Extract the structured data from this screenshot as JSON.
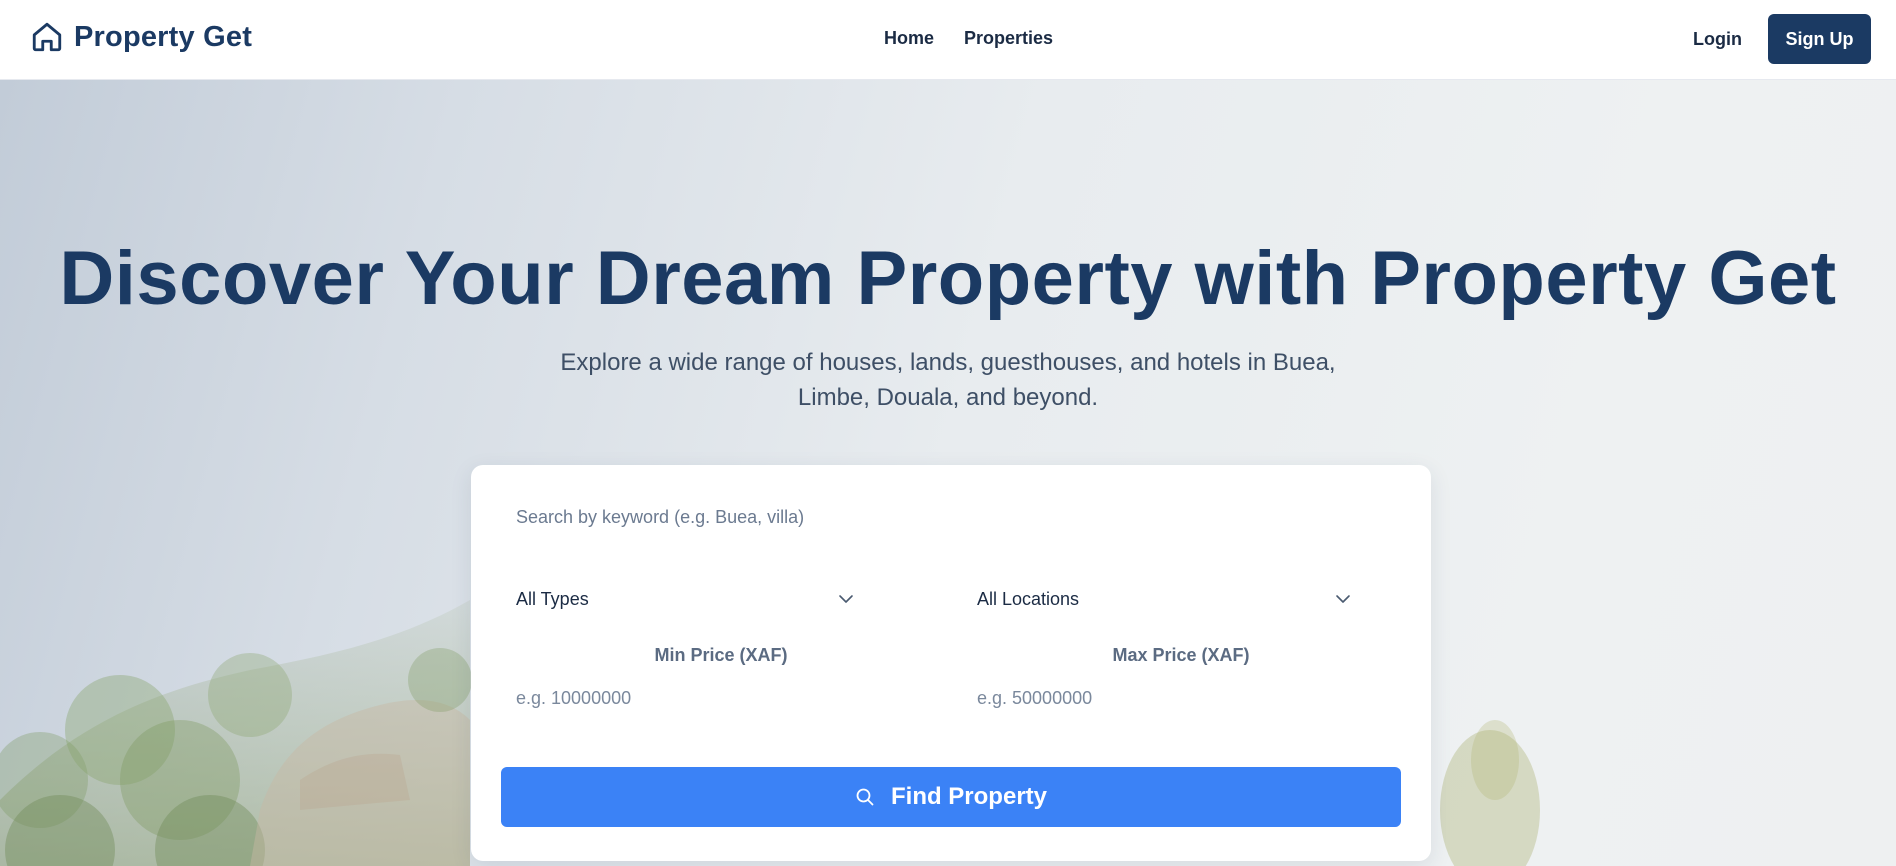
{
  "brand": {
    "name": "Property Get",
    "icon": "home-icon"
  },
  "nav": {
    "links": [
      {
        "label": "Home"
      },
      {
        "label": "Properties"
      }
    ],
    "login_label": "Login",
    "signup_label": "Sign Up"
  },
  "hero": {
    "title": "Discover Your Dream Property with Property Get",
    "subtitle": "Explore a wide range of houses, lands, guesthouses, and hotels in Buea, Limbe, Douala, and beyond."
  },
  "search": {
    "keyword_placeholder": "Search by keyword (e.g. Buea, villa)",
    "type_select": {
      "selected": "All Types",
      "icon": "chevron-down-icon"
    },
    "location_select": {
      "selected": "All Locations",
      "icon": "chevron-down-icon"
    },
    "min_price": {
      "label": "Min Price (XAF)",
      "placeholder": "e.g. 10000000"
    },
    "max_price": {
      "label": "Max Price (XAF)",
      "placeholder": "e.g. 50000000"
    },
    "submit_label": "Find Property",
    "submit_icon": "search-icon"
  },
  "colors": {
    "brand_navy": "#1b3a63",
    "primary_blue": "#3b82f6",
    "subtitle_gray": "#3e4f66",
    "label_gray": "#5b6b82"
  }
}
